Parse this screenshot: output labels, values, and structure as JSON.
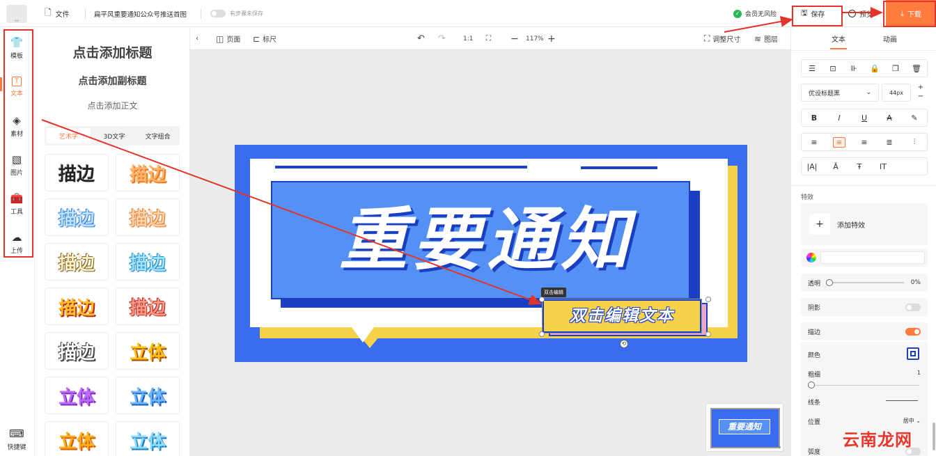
{
  "topbar": {
    "file_label": "文件",
    "doc_title": "扁平风重要通知公众号推送首图",
    "sync_label": "有步骤未保存",
    "member_label": "会员无风险",
    "save_label": "保存",
    "preview_label": "预览",
    "download_label": "下载",
    "accent": "#ff7a3d"
  },
  "rail": {
    "items": [
      {
        "label": "模板",
        "icon": "shirt-icon"
      },
      {
        "label": "文本",
        "icon": "text-box-icon"
      },
      {
        "label": "素材",
        "icon": "shapes-icon"
      },
      {
        "label": "图片",
        "icon": "image-icon"
      },
      {
        "label": "工具",
        "icon": "toolbox-icon"
      },
      {
        "label": "上传",
        "icon": "cloud-upload-icon"
      }
    ],
    "shortcut_label": "快捷键"
  },
  "text_panel": {
    "add_title": "点击添加标题",
    "add_subtitle": "点击添加副标题",
    "add_body": "点击添加正文",
    "tabs": [
      "艺术字",
      "3D文字",
      "文字组合"
    ],
    "styles": [
      "描边",
      "描边",
      "描边",
      "描边",
      "描边",
      "描边",
      "描边",
      "描边",
      "描边",
      "立体",
      "立体",
      "立体",
      "立体",
      "立体"
    ]
  },
  "canvas_bar": {
    "page_label": "页面",
    "ruler_label": "标尺",
    "ratio_label": "1:1",
    "zoom": "117%",
    "resize_label": "调整尺寸",
    "layers_label": "图层"
  },
  "design": {
    "main_text": "重要通知",
    "sub_text": "双击编辑文本",
    "tooltip": "双击编辑",
    "colors": {
      "blue": "#3a6cf0",
      "yellow": "#f7d14a",
      "navy": "#1a3fc0",
      "light_blue": "#5591f5"
    }
  },
  "right_panel": {
    "tab_text": "文本",
    "tab_anim": "动画",
    "font_name": "优设标题黑",
    "font_size": "44px",
    "effects_label": "特效",
    "add_effect_label": "添加特效",
    "opacity_label": "透明",
    "opacity_value": "0%",
    "shadow_label": "阴影",
    "stroke_label": "描边",
    "color_label": "颜色",
    "thickness_label": "粗细",
    "thickness_value": "1",
    "line_label": "线条",
    "position_label": "位置",
    "position_value": "居中",
    "curve_label": "弧度"
  },
  "watermark": "云南龙网"
}
